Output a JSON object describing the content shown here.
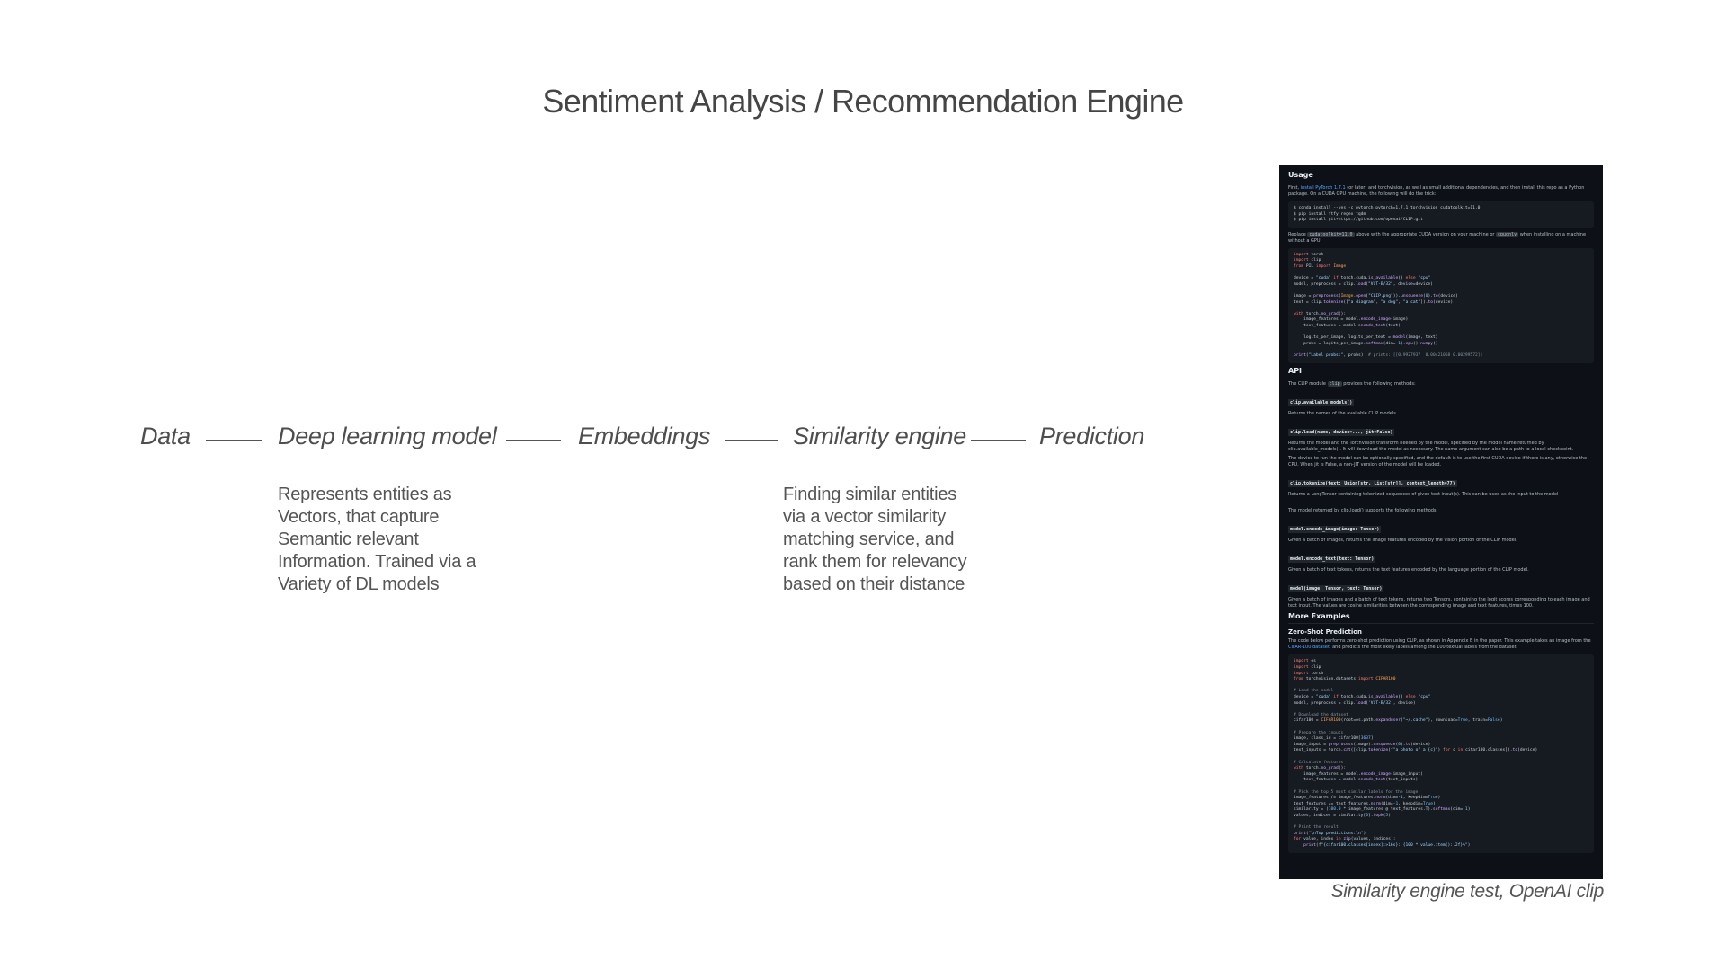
{
  "slide": {
    "title": "Sentiment Analysis / Recommendation Engine"
  },
  "pipeline": {
    "nodes": [
      {
        "label": "Data"
      },
      {
        "label": "Deep learning model"
      },
      {
        "label": "Embeddings"
      },
      {
        "label": "Similarity engine"
      },
      {
        "label": "Prediction"
      }
    ],
    "descriptions": {
      "deep_learning_model": "Represents entities as Vectors, that capture Semantic relevant Information. Trained via a Variety of DL models",
      "similarity_engine": "Finding similar entities via a vector similarity matching service, and rank them for relevancy based on their distance"
    }
  },
  "screenshot": {
    "caption": "Similarity engine test, OpenAI clip",
    "usage": {
      "heading": "Usage",
      "intro_prefix": "First, ",
      "intro_link": "install PyTorch 1.7.1",
      "intro_suffix": " (or later) and torchvision, as well as small additional dependencies, and then install this repo as a Python package. On a CUDA GPU machine, the following will do the trick:",
      "install_code": "$ conda install --yes -c pytorch pytorch=1.7.1 torchvision cudatoolkit=11.0\n$ pip install ftfy regex tqdm\n$ pip install git+https://github.com/openai/CLIP.git",
      "replace_prefix": "Replace ",
      "replace_code": "cudatoolkit=11.0",
      "replace_mid": " above with the appropriate CUDA version on your machine or ",
      "replace_code2": "cpuonly",
      "replace_suffix": " when installing on a machine without a GPU."
    },
    "api": {
      "heading": "API",
      "intro_prefix": "The CLIP module ",
      "intro_code": "clip",
      "intro_suffix": " provides the following methods:",
      "methods": [
        {
          "sig": "clip.available_models()",
          "desc": "Returns the names of the available CLIP models."
        },
        {
          "sig": "clip.load(name, device=..., jit=False)",
          "desc": "Returns the model and the TorchVision transform needed by the model, specified by the model name returned by clip.available_models(). It will download the model as necessary. The name argument can also be a path to a local checkpoint."
        },
        {
          "sig": "",
          "desc": "The device to run the model can be optionally specified, and the default is to use the first CUDA device if there is any, otherwise the CPU. When jit is False, a non-JIT version of the model will be loaded."
        },
        {
          "sig": "clip.tokenize(text: Union[str, List[str]], context_length=77)",
          "desc": "Returns a LongTensor containing tokenized sequences of given text input(s). This can be used as the input to the model"
        }
      ],
      "model_intro": "The model returned by clip.load() supports the following methods:",
      "model_methods": [
        {
          "sig": "model.encode_image(image: Tensor)",
          "desc": "Given a batch of images, returns the image features encoded by the vision portion of the CLIP model."
        },
        {
          "sig": "model.encode_text(text: Tensor)",
          "desc": "Given a batch of text tokens, returns the text features encoded by the language portion of the CLIP model."
        },
        {
          "sig": "model(image: Tensor, text: Tensor)",
          "desc": "Given a batch of images and a batch of text tokens, returns two Tensors, containing the logit scores corresponding to each image and text input. The values are cosine similarities between the corresponding image and text features, times 100."
        }
      ]
    },
    "examples": {
      "heading": "More Examples",
      "subheading": "Zero-Shot Prediction",
      "intro_prefix": "The code below performs zero-shot prediction using CLIP, as shown in Appendix B in the paper. This example takes an image from the ",
      "intro_link": "CIFAR-100 dataset",
      "intro_suffix": ", and predicts the most likely labels among the 100 textual labels from the dataset."
    }
  }
}
